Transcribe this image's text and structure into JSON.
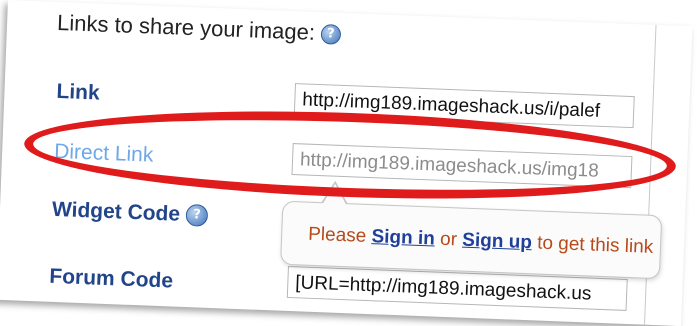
{
  "panel": {
    "heading": "Links to share your image:",
    "help_icon": "?"
  },
  "rows": [
    {
      "label": "Link",
      "value": "http://img189.imageshack.us/i/palef"
    },
    {
      "label": "Direct Link",
      "value": "http://img189.imageshack.us/img18"
    },
    {
      "label": "Widget Code",
      "value": ""
    },
    {
      "label": "Forum Code",
      "value": "[URL=http://img189.imageshack.us"
    }
  ],
  "tooltip": {
    "prefix": "Please ",
    "sign_in": "Sign in",
    "middle": " or ",
    "sign_up": "Sign up",
    "suffix": " to get this link"
  },
  "colors": {
    "label": "#22458a",
    "direct_link_label": "#6fa8e8",
    "highlight": "#e01b1b",
    "tooltip_text": "#b64a1b",
    "tooltip_link": "#1f3f9a"
  }
}
